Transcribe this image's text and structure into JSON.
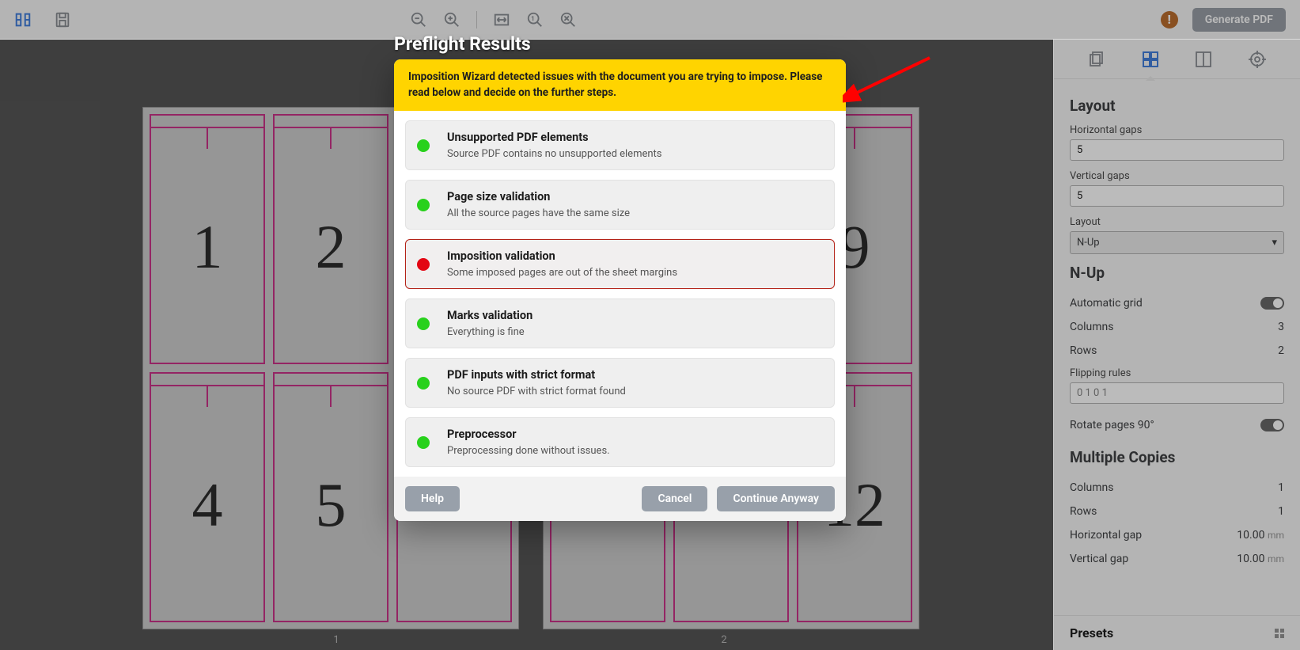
{
  "toolbar": {
    "generate_label": "Generate PDF"
  },
  "modal": {
    "title": "Preflight Results",
    "warning": "Imposition Wizard detected issues with the document you are trying to impose. Please read below and decide on the further steps.",
    "checks": [
      {
        "status": "ok",
        "title": "Unsupported PDF elements",
        "desc": "Source PDF contains no unsupported elements"
      },
      {
        "status": "ok",
        "title": "Page size validation",
        "desc": "All the source pages have the same size"
      },
      {
        "status": "err",
        "title": "Imposition validation",
        "desc": "Some imposed pages are out of the sheet margins"
      },
      {
        "status": "ok",
        "title": "Marks validation",
        "desc": "Everything is fine"
      },
      {
        "status": "ok",
        "title": "PDF inputs with strict format",
        "desc": "No source PDF with strict format found"
      },
      {
        "status": "ok",
        "title": "Preprocessor",
        "desc": "Preprocessing done without issues."
      }
    ],
    "buttons": {
      "help": "Help",
      "cancel": "Cancel",
      "continue": "Continue Anyway"
    }
  },
  "sheets": {
    "s1": {
      "label": "1",
      "pages": [
        "1",
        "2",
        "",
        "4",
        "5",
        ""
      ]
    },
    "s2": {
      "label": "2",
      "pages": [
        "",
        "",
        "9",
        "",
        "",
        "12"
      ]
    }
  },
  "panel": {
    "layout_title": "Layout",
    "hgap_label": "Horizontal gaps",
    "hgap_value": "5",
    "vgap_label": "Vertical gaps",
    "vgap_value": "5",
    "layout_label": "Layout",
    "layout_value": "N-Up",
    "nup_title": "N-Up",
    "auto_grid_label": "Automatic grid",
    "columns_label": "Columns",
    "columns_value": "3",
    "rows_label": "Rows",
    "rows_value": "2",
    "flip_label": "Flipping rules",
    "flip_placeholder": "0 1 0 1",
    "rotate_label": "Rotate pages 90°",
    "mc_title": "Multiple Copies",
    "mc_cols_label": "Columns",
    "mc_cols_value": "1",
    "mc_rows_label": "Rows",
    "mc_rows_value": "1",
    "mc_hgap_label": "Horizontal gap",
    "mc_hgap_value": "10.00",
    "mc_vgap_label": "Vertical gap",
    "mc_vgap_value": "10.00",
    "gap_unit": "mm",
    "presets_label": "Presets"
  }
}
